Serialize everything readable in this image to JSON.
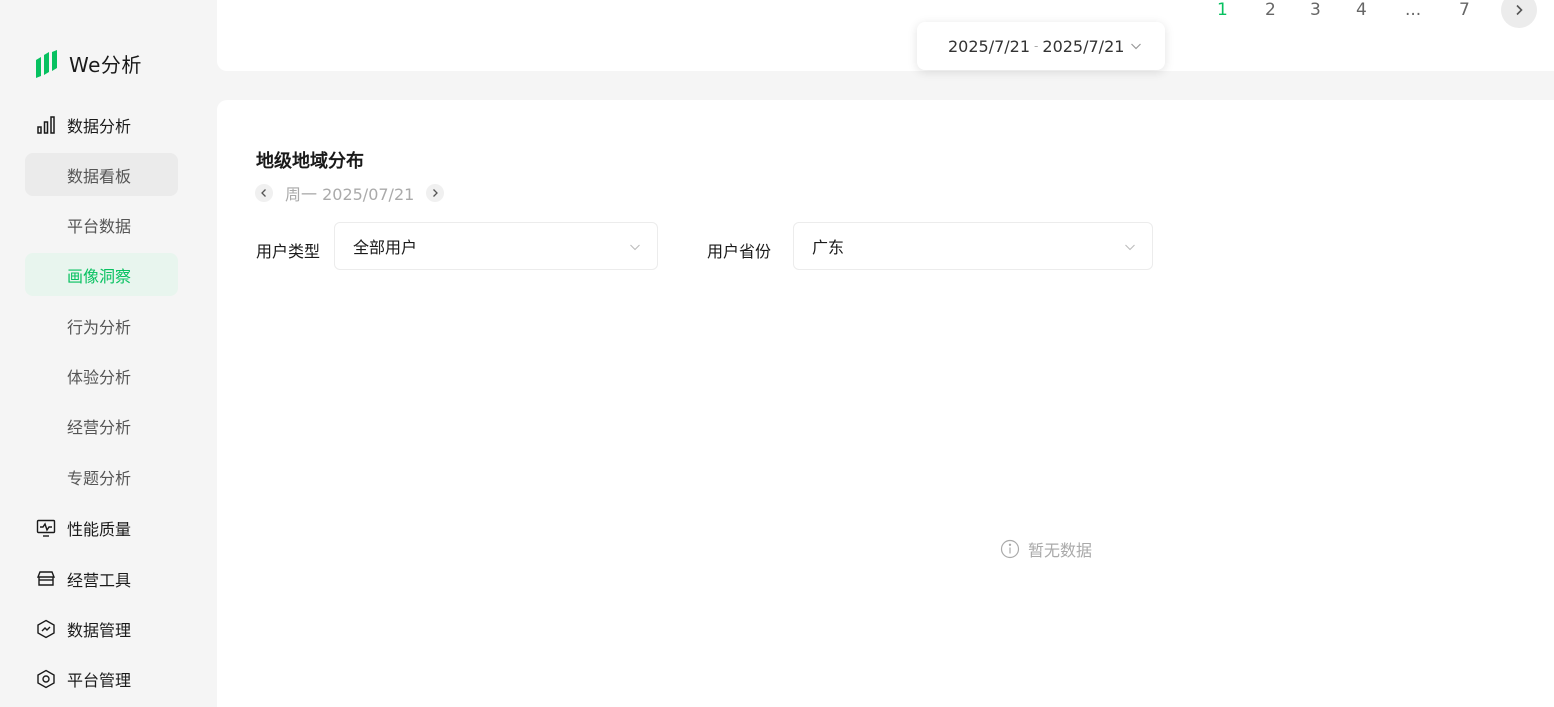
{
  "app": {
    "name": "We分析"
  },
  "sidebar": {
    "sections": [
      {
        "label": "数据分析",
        "icon": "bar-chart-icon"
      },
      {
        "label": "性能质量",
        "icon": "monitor-icon"
      },
      {
        "label": "经营工具",
        "icon": "store-icon"
      },
      {
        "label": "数据管理",
        "icon": "data-shield-icon"
      },
      {
        "label": "平台管理",
        "icon": "settings-hex-icon"
      }
    ],
    "items": [
      {
        "label": "数据看板"
      },
      {
        "label": "平台数据"
      },
      {
        "label": "画像洞察"
      },
      {
        "label": "行为分析"
      },
      {
        "label": "体验分析"
      },
      {
        "label": "经营分析"
      },
      {
        "label": "专题分析"
      }
    ]
  },
  "pagination": {
    "pages": [
      "1",
      "2",
      "3",
      "4",
      "...",
      "7"
    ],
    "current": "1"
  },
  "date_range": {
    "start": "2025/7/21",
    "separator": "-",
    "end": "2025/7/21"
  },
  "main": {
    "title": "地级地域分布",
    "date_label": "周一 2025/07/21",
    "filters": {
      "user_type": {
        "label": "用户类型",
        "value": "全部用户"
      },
      "province": {
        "label": "用户省份",
        "value": "广东"
      }
    },
    "empty_text": "暂无数据"
  },
  "colors": {
    "accent": "#07c160",
    "active_bg": "#e8f5ee"
  }
}
